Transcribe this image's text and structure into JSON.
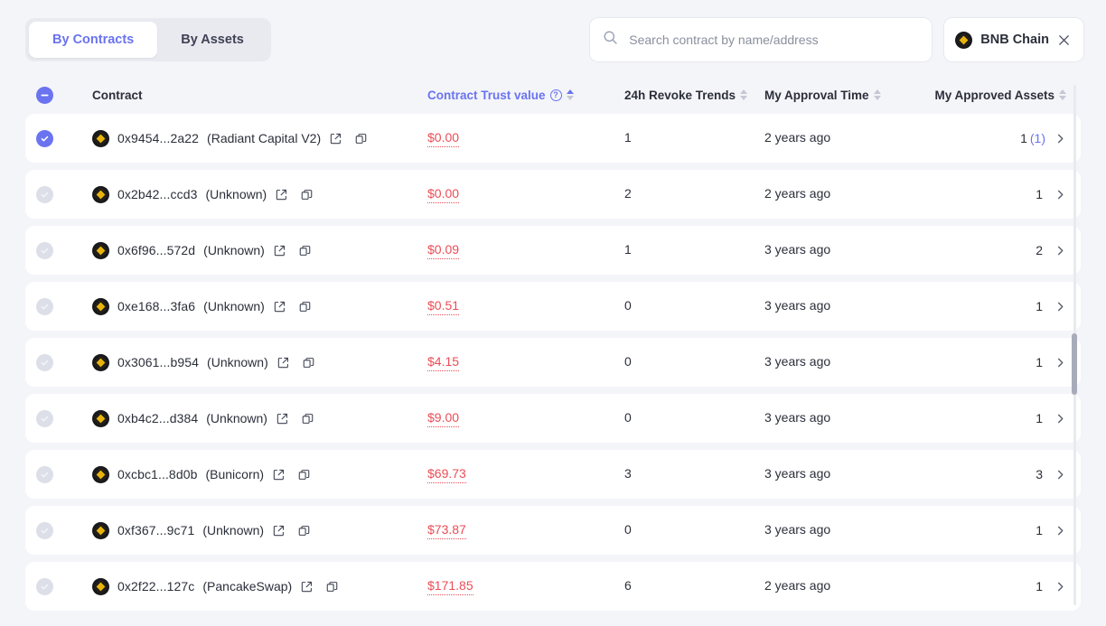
{
  "tabs": [
    {
      "label": "By Contracts",
      "active": true
    },
    {
      "label": "By Assets",
      "active": false
    }
  ],
  "search": {
    "placeholder": "Search contract by name/address",
    "value": "",
    "icon": "search-icon"
  },
  "chain_filter": {
    "name": "BNB Chain",
    "icon": "bnb-chain-icon",
    "close_icon": "close-icon"
  },
  "table": {
    "headers": {
      "contract": "Contract",
      "trust": "Contract Trust value",
      "revoke": "24h Revoke Trends",
      "time": "My Approval Time",
      "assets": "My Approved Assets"
    },
    "sorted_column": "trust",
    "sort_direction": "asc",
    "select_all_state": "indeterminate",
    "rows": [
      {
        "checked": true,
        "address": "0x9454...2a22",
        "name": "(Radiant Capital V2)",
        "trust": "$0.00",
        "revoke": "1",
        "time": "2 years ago",
        "assets": "1",
        "assets_extra": "(1)"
      },
      {
        "checked": false,
        "address": "0x2b42...ccd3",
        "name": "(Unknown)",
        "trust": "$0.00",
        "revoke": "2",
        "time": "2 years ago",
        "assets": "1",
        "assets_extra": ""
      },
      {
        "checked": false,
        "address": "0x6f96...572d",
        "name": "(Unknown)",
        "trust": "$0.09",
        "revoke": "1",
        "time": "3 years ago",
        "assets": "2",
        "assets_extra": ""
      },
      {
        "checked": false,
        "address": "0xe168...3fa6",
        "name": "(Unknown)",
        "trust": "$0.51",
        "revoke": "0",
        "time": "3 years ago",
        "assets": "1",
        "assets_extra": ""
      },
      {
        "checked": false,
        "address": "0x3061...b954",
        "name": "(Unknown)",
        "trust": "$4.15",
        "revoke": "0",
        "time": "3 years ago",
        "assets": "1",
        "assets_extra": ""
      },
      {
        "checked": false,
        "address": "0xb4c2...d384",
        "name": "(Unknown)",
        "trust": "$9.00",
        "revoke": "0",
        "time": "3 years ago",
        "assets": "1",
        "assets_extra": ""
      },
      {
        "checked": false,
        "address": "0xcbc1...8d0b",
        "name": "(Bunicorn)",
        "trust": "$69.73",
        "revoke": "3",
        "time": "3 years ago",
        "assets": "3",
        "assets_extra": ""
      },
      {
        "checked": false,
        "address": "0xf367...9c71",
        "name": "(Unknown)",
        "trust": "$73.87",
        "revoke": "0",
        "time": "3 years ago",
        "assets": "1",
        "assets_extra": ""
      },
      {
        "checked": false,
        "address": "0x2f22...127c",
        "name": "(PancakeSwap)",
        "trust": "$171.85",
        "revoke": "6",
        "time": "2 years ago",
        "assets": "1",
        "assets_extra": ""
      }
    ]
  },
  "colors": {
    "accent": "#6a73f0",
    "danger": "#ec4d56",
    "page_bg": "#f4f5f9",
    "row_bg": "#ffffff",
    "text": "#2b2f3a"
  }
}
